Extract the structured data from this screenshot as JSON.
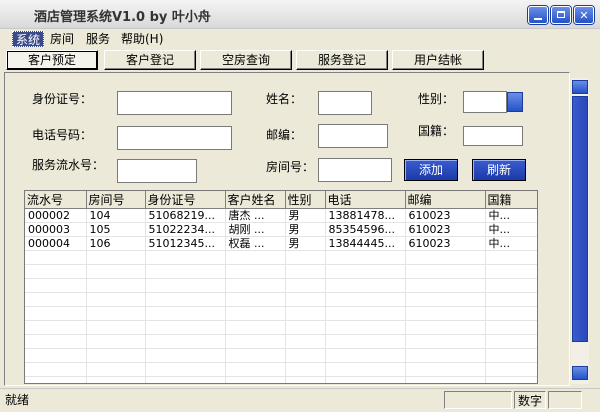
{
  "window": {
    "title": "酒店管理系统V1.0 by 叶小舟"
  },
  "menu": [
    "系统",
    "房间",
    "服务",
    "帮助(H)"
  ],
  "tabs": [
    "客户预定",
    "客户登记",
    "空房查询",
    "服务登记",
    "用户结帐"
  ],
  "form": {
    "id_label": "身份证号：",
    "phone_label": "电话号码：",
    "serial_label": "服务流水号：",
    "name_label": "姓名：",
    "zip_label": "邮编：",
    "room_label": "房间号：",
    "gender_label": "性别：",
    "country_label": "国籍：",
    "add_button": "添加",
    "refresh_button": "刷新"
  },
  "table": {
    "columns": [
      "流水号",
      "房间号",
      "身份证号",
      "客户姓名",
      "性别",
      "电话",
      "邮编",
      "国籍"
    ],
    "rows": [
      [
        "000002",
        "104",
        "51068219...",
        "唐杰 ...",
        "男",
        "13881478...",
        "610023",
        "中..."
      ],
      [
        "000003",
        "105",
        "51022234...",
        "胡刚 ...",
        "男",
        "85354596...",
        "610023",
        "中..."
      ],
      [
        "000004",
        "106",
        "51012345...",
        "权磊 ...",
        "男",
        "13844445...",
        "610023",
        "中..."
      ]
    ]
  },
  "status": {
    "left": "就绪",
    "right": "数字"
  },
  "colors": {
    "accent_blue": "#2452c8",
    "face": "#ece9d8"
  }
}
